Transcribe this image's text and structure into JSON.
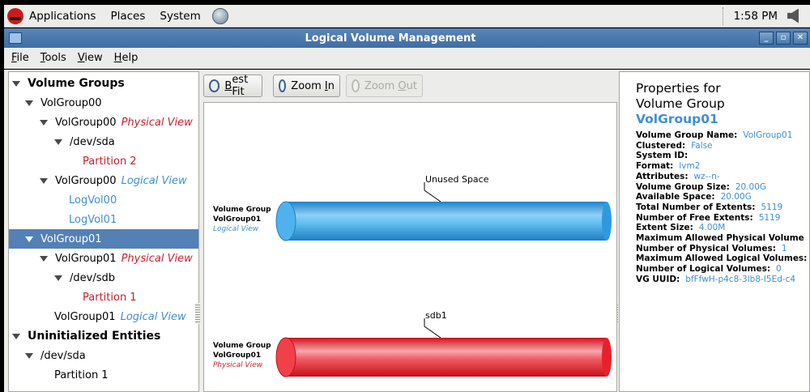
{
  "panel": {
    "menus": [
      "Applications",
      "Places",
      "System"
    ],
    "clock": "1:58 PM",
    "icons": [
      "redhat-icon",
      "network-icon",
      "volume-icon"
    ]
  },
  "window": {
    "title": "Logical Volume Management",
    "controls": [
      "minimize",
      "maximize",
      "close"
    ]
  },
  "menubar": {
    "items": [
      {
        "underline": "F",
        "rest": "ile"
      },
      {
        "underline": "T",
        "rest": "ools"
      },
      {
        "underline": "V",
        "rest": "iew"
      },
      {
        "underline": "H",
        "rest": "elp"
      }
    ]
  },
  "tree": {
    "rows": [
      {
        "text": "Volume Groups",
        "suffix": ""
      },
      {
        "text": "VolGroup00",
        "suffix": ""
      },
      {
        "text": "VolGroup00",
        "suffix": "Physical View"
      },
      {
        "text": "/dev/sda",
        "suffix": ""
      },
      {
        "text": "Partition 2",
        "suffix": ""
      },
      {
        "text": "VolGroup00",
        "suffix": "Logical View"
      },
      {
        "text": "LogVol00",
        "suffix": ""
      },
      {
        "text": "LogVol01",
        "suffix": ""
      },
      {
        "text": "VolGroup01",
        "suffix": ""
      },
      {
        "text": "VolGroup01",
        "suffix": "Physical View"
      },
      {
        "text": "/dev/sdb",
        "suffix": ""
      },
      {
        "text": "Partition 1",
        "suffix": ""
      },
      {
        "text": "VolGroup01",
        "suffix": "Logical View"
      },
      {
        "text": "Uninitialized Entities",
        "suffix": ""
      },
      {
        "text": "/dev/sda",
        "suffix": ""
      },
      {
        "text": "Partition 1",
        "suffix": ""
      }
    ]
  },
  "toolbar": {
    "best_fit": {
      "underline": "B",
      "rest": "est Fit"
    },
    "zoom_in": {
      "before": "Zoom ",
      "underline": "I",
      "rest": "n"
    },
    "zoom_out": {
      "before": "Zoom ",
      "underline": "O",
      "rest": "ut"
    }
  },
  "canvas": {
    "logical": {
      "line1": "Volume Group",
      "line2": "VolGroup01",
      "line3": "Logical View",
      "callout": "Unused Space",
      "color": "#2d9ae0"
    },
    "physical": {
      "line1": "Volume Group",
      "line2": "VolGroup01",
      "line3": "Physical View",
      "callout": "sdb1",
      "color": "#e8202c"
    }
  },
  "properties": {
    "heading1": "Properties for",
    "heading2": "Volume Group",
    "name": "VolGroup01",
    "fields": [
      {
        "label": "Volume Group Name:",
        "value": "VolGroup01"
      },
      {
        "label": "Clustered:",
        "value": "False"
      },
      {
        "label": "System ID:",
        "value": ""
      },
      {
        "label": "Format:",
        "value": "lvm2"
      },
      {
        "label": "Attributes:",
        "value": "wz--n-"
      },
      {
        "label": "Volume Group Size:",
        "value": "20.00G"
      },
      {
        "label": "Available Space:",
        "value": "20.00G"
      },
      {
        "label": "Total Number of Extents:",
        "value": "5119"
      },
      {
        "label": "Number of Free Extents:",
        "value": "5119"
      },
      {
        "label": "Extent Size:",
        "value": "4.00M"
      },
      {
        "label": "Maximum Allowed Physical Volume",
        "value": ""
      },
      {
        "label": "Number of Physical Volumes:",
        "value": "1"
      },
      {
        "label": "Maximum Allowed Logical Volumes:",
        "value": ""
      },
      {
        "label": "Number of Logical Volumes:",
        "value": "0"
      },
      {
        "label": "VG UUID:",
        "value": "bfFfwH-p4c8-3lb8-I5Ed-c4"
      }
    ]
  }
}
